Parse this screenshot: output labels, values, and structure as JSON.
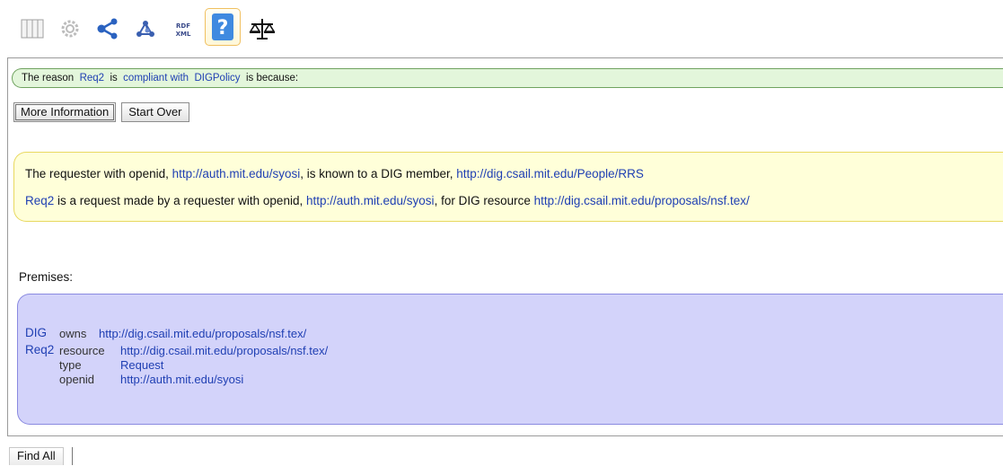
{
  "toolbar": {
    "icons": [
      {
        "name": "table-view-icon"
      },
      {
        "name": "settings-gear-icon"
      },
      {
        "name": "share-graph-icon"
      },
      {
        "name": "molecule-graph-icon"
      },
      {
        "name": "rdf-xml-icon",
        "label_top": "RDF",
        "label_bottom": "XML"
      },
      {
        "name": "help-question-icon",
        "label": "?"
      },
      {
        "name": "justice-scales-icon"
      }
    ]
  },
  "reason": {
    "prefix": "The reason",
    "subject": "Req2",
    "is": "is",
    "relation": "compliant with",
    "policy": "DIGPolicy",
    "suffix": "is because:"
  },
  "buttons": {
    "more_info": "More Information",
    "start_over": "Start Over"
  },
  "justification": {
    "line1": {
      "text_a": "The requester with openid,",
      "link_a": "http://auth.mit.edu/syosi",
      "text_b": ", is known to a DIG member,",
      "link_b": "http://dig.csail.mit.edu/People/RRS"
    },
    "line2": {
      "link_a": "Req2",
      "text_a": "is a request made by a requester with openid,",
      "link_b": "http://auth.mit.edu/syosi",
      "text_b": ", for DIG resource",
      "link_c": "http://dig.csail.mit.edu/proposals/nsf.tex/"
    }
  },
  "premises": {
    "label": "Premises:",
    "rows": [
      {
        "subject": "DIG",
        "predicate": "owns",
        "object": "http://dig.csail.mit.edu/proposals/nsf.tex/"
      },
      {
        "subject": "Req2",
        "predicate": "resource",
        "object": "http://dig.csail.mit.edu/proposals/nsf.tex/"
      },
      {
        "subject": "",
        "predicate": "type",
        "object": "Request"
      },
      {
        "subject": "",
        "predicate": "openid",
        "object": "http://auth.mit.edu/syosi"
      }
    ]
  },
  "footer": {
    "find_all": "Find All"
  },
  "colors": {
    "link": "#1f3fb3",
    "reason_bg": "#e3f6db",
    "justification_bg": "#ffffd9",
    "premises_bg": "#d3d3fa"
  }
}
